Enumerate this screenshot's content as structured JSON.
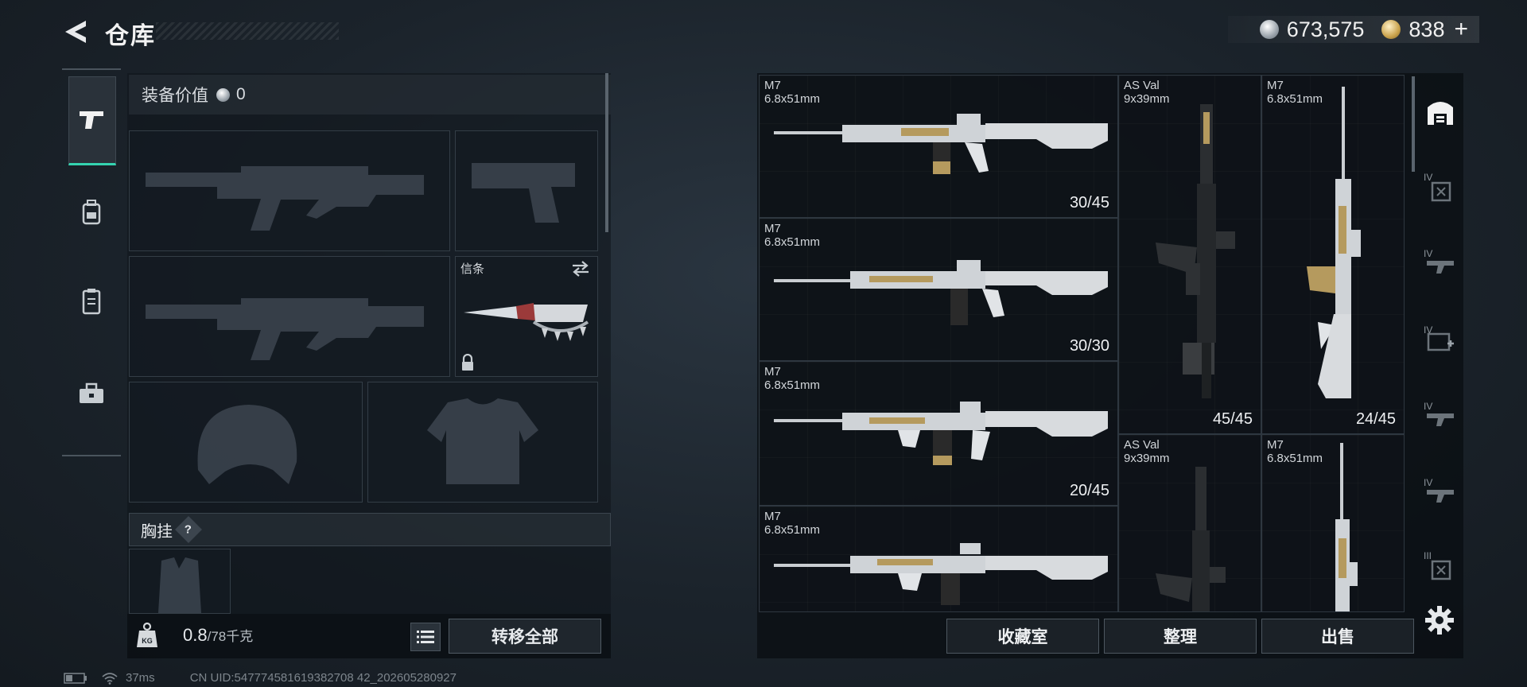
{
  "header": {
    "title": "仓库",
    "currency_silver": "673,575",
    "currency_gold": "838",
    "plus_label": "+"
  },
  "left_nav": {
    "icons": [
      "pistol-icon",
      "backpack-icon",
      "vest-icon",
      "toolbox-icon"
    ]
  },
  "equipment": {
    "value_label": "装备价值",
    "value_amount": "0",
    "slots": [
      {
        "id": "primary-weapon-1",
        "type": "rifle"
      },
      {
        "id": "pistol",
        "type": "pistol"
      },
      {
        "id": "primary-weapon-2",
        "type": "rifle"
      },
      {
        "id": "melee",
        "label": "信条",
        "type": "knife",
        "locked": true
      },
      {
        "id": "helmet",
        "type": "helmet"
      },
      {
        "id": "armor",
        "type": "armor"
      }
    ],
    "chest_label": "胸挂",
    "chest_help": "?",
    "weight_value": "0.8",
    "weight_max": "/78千克",
    "transfer_label": "转移全部"
  },
  "inventory": {
    "items": [
      {
        "name": "M7",
        "caliber": "6.8x51mm",
        "ammo": "30/45"
      },
      {
        "name": "M7",
        "caliber": "6.8x51mm",
        "ammo": "30/30"
      },
      {
        "name": "M7",
        "caliber": "6.8x51mm",
        "ammo": "20/45"
      },
      {
        "name": "M7",
        "caliber": "6.8x51mm",
        "ammo": ""
      },
      {
        "name": "AS Val",
        "caliber": "9x39mm",
        "ammo": "45/45"
      },
      {
        "name": "M7",
        "caliber": "6.8x51mm",
        "ammo": "24/45"
      },
      {
        "name": "AS Val",
        "caliber": "9x39mm",
        "ammo": ""
      },
      {
        "name": "M7",
        "caliber": "6.8x51mm",
        "ammo": ""
      }
    ],
    "actions": [
      "收藏室",
      "整理",
      "出售"
    ]
  },
  "right_nav": {
    "tiers": [
      "",
      "IV",
      "IV",
      "IV",
      "IV",
      "IV",
      "III"
    ]
  },
  "status": {
    "ping": "37ms",
    "uid": "CN UID:547774581619382708 42_202605280927"
  },
  "colors": {
    "accent": "#34d3b0",
    "gold_trim": "#b59a5e"
  }
}
